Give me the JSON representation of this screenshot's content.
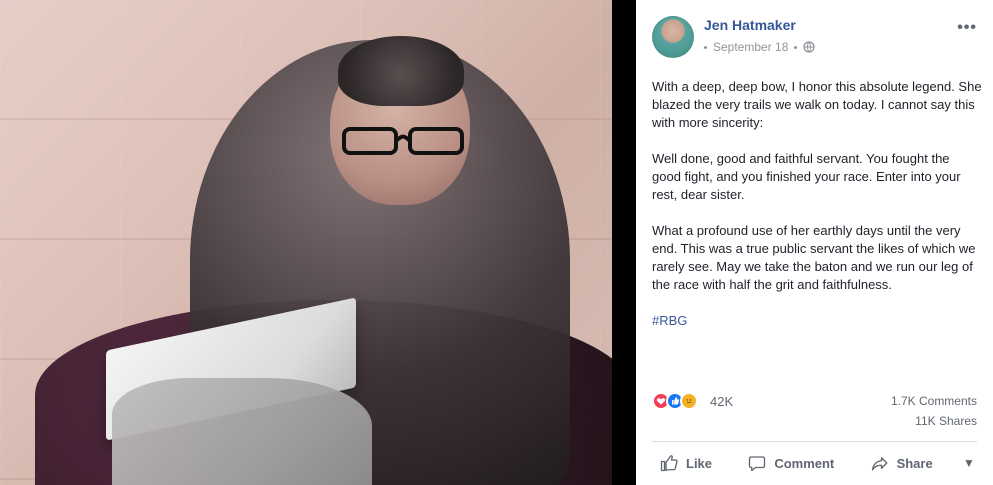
{
  "post": {
    "author_name": "Jen Hatmaker",
    "date": "September 18",
    "body_paragraphs": [
      "With a deep, deep bow, I honor this absolute legend. She blazed the very trails we walk on today. I cannot say this with more sincerity:",
      "Well done, good and faithful servant. You fought the good fight, and you finished your race. Enter into your rest, dear sister.",
      "What a profound use of her earthly days until the very end. This was a true public servant the likes of which we rarely see. May we take the baton and we run our leg of the race with half the grit and faithfulness."
    ],
    "hashtag": "#RBG",
    "reaction_count": "42K",
    "comments_count": "1.7K Comments",
    "shares_count": "11K Shares"
  },
  "actions": {
    "like_label": "Like",
    "comment_label": "Comment",
    "share_label": "Share"
  },
  "icons": {
    "more": "more-options-icon",
    "privacy": "globe-icon",
    "reaction_love": "love-reaction-icon",
    "reaction_like": "like-reaction-icon",
    "reaction_sad": "sad-reaction-icon",
    "like": "thumbs-up-icon",
    "comment": "comment-bubble-icon",
    "share": "share-arrow-icon",
    "dropdown": "dropdown-caret-icon"
  },
  "colors": {
    "link_blue": "#365899",
    "meta_gray": "#90949c",
    "text_dark": "#1d2129",
    "action_gray": "#606770",
    "divider": "#dadde1",
    "background_black": "#000000"
  }
}
